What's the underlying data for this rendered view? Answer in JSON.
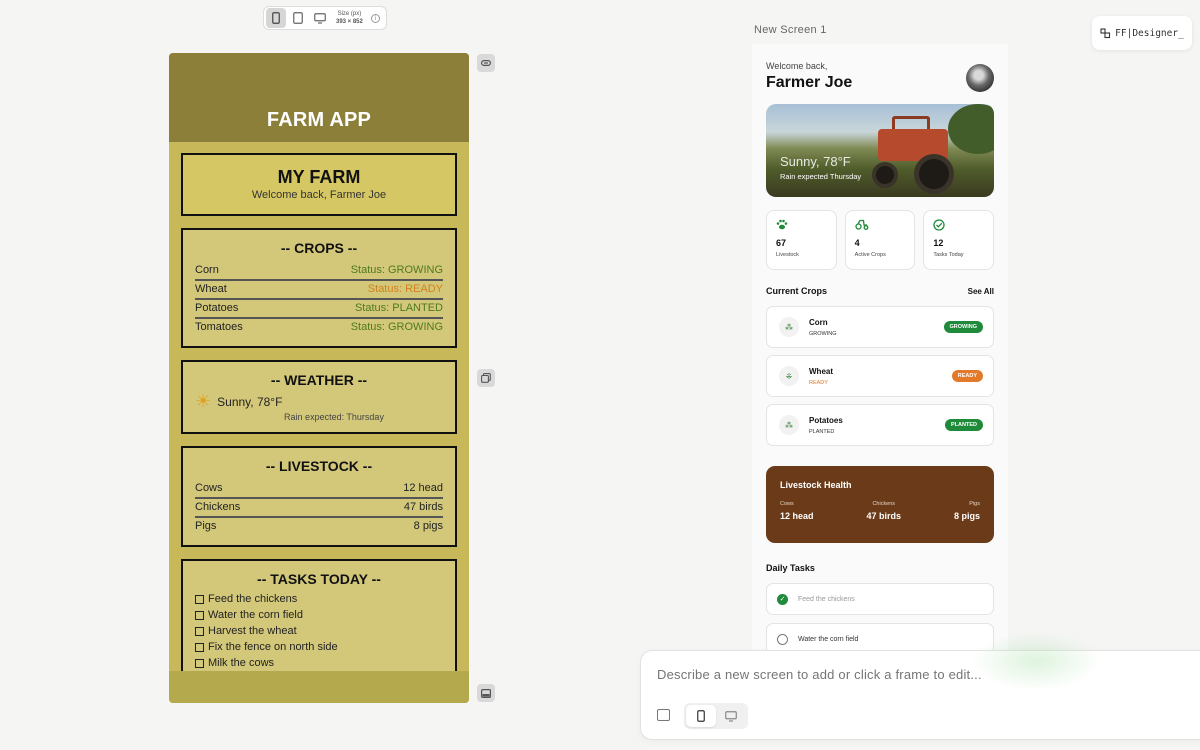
{
  "toolbar": {
    "size_label": "Size (px)",
    "size_value": "393 × 852"
  },
  "farm_app": {
    "title": "FARM APP",
    "my_farm": {
      "title": "MY FARM",
      "subtitle": "Welcome back, Farmer Joe"
    },
    "crops": {
      "title": "-- CROPS --",
      "rows": [
        {
          "name": "Corn",
          "status": "Status: GROWING"
        },
        {
          "name": "Wheat",
          "status": "Status: READY"
        },
        {
          "name": "Potatoes",
          "status": "Status: PLANTED"
        },
        {
          "name": "Tomatoes",
          "status": "Status: GROWING"
        }
      ]
    },
    "weather": {
      "title": "-- WEATHER --",
      "current": "Sunny, 78°F",
      "rain": "Rain expected: Thursday"
    },
    "livestock": {
      "title": "-- LIVESTOCK --",
      "rows": [
        {
          "name": "Cows",
          "value": "12 head"
        },
        {
          "name": "Chickens",
          "value": "47 birds"
        },
        {
          "name": "Pigs",
          "value": "8 pigs"
        }
      ]
    },
    "tasks": {
      "title": "-- TASKS TODAY --",
      "items": [
        "Feed the chickens",
        "Water the corn field",
        "Harvest the wheat",
        "Fix the fence on north side",
        "Milk the cows"
      ]
    }
  },
  "screen": {
    "label": "New Screen 1",
    "badge": "FF|Designer_",
    "welcome": "Welcome back,",
    "farmer": "Farmer Joe",
    "hero": {
      "temp": "Sunny, 78°F",
      "rain": "Rain expected Thursday"
    },
    "stats": [
      {
        "value": "67",
        "label": "Livestock",
        "icon": "paw-icon"
      },
      {
        "value": "4",
        "label": "Active Crops",
        "icon": "tractor-icon"
      },
      {
        "value": "12",
        "label": "Tasks Today",
        "icon": "check-circle-icon"
      }
    ],
    "current_crops": {
      "title": "Current Crops",
      "see_all": "See All",
      "items": [
        {
          "name": "Corn",
          "status": "GROWING",
          "badge": "GROWING"
        },
        {
          "name": "Wheat",
          "status": "READY",
          "badge": "READY"
        },
        {
          "name": "Potatoes",
          "status": "PLANTED",
          "badge": "PLANTED"
        }
      ]
    },
    "livestock_health": {
      "title": "Livestock Health",
      "items": [
        {
          "label": "Cows",
          "value": "12 head"
        },
        {
          "label": "Chickens",
          "value": "47 birds"
        },
        {
          "label": "Pigs",
          "value": "8 pigs"
        }
      ]
    },
    "daily_tasks": {
      "title": "Daily Tasks",
      "items": [
        {
          "text": "Feed the chickens",
          "done": true
        },
        {
          "text": "Water the corn field",
          "done": false
        }
      ]
    }
  },
  "prompt": {
    "placeholder": "Describe a new screen to add or click a frame to edit..."
  },
  "colors": {
    "farm_header": "#8b7f3a",
    "farm_body": "#c7b85a",
    "green": "#1f8a3a",
    "orange": "#e27a2a",
    "livestock_bg": "#6b3a18"
  }
}
